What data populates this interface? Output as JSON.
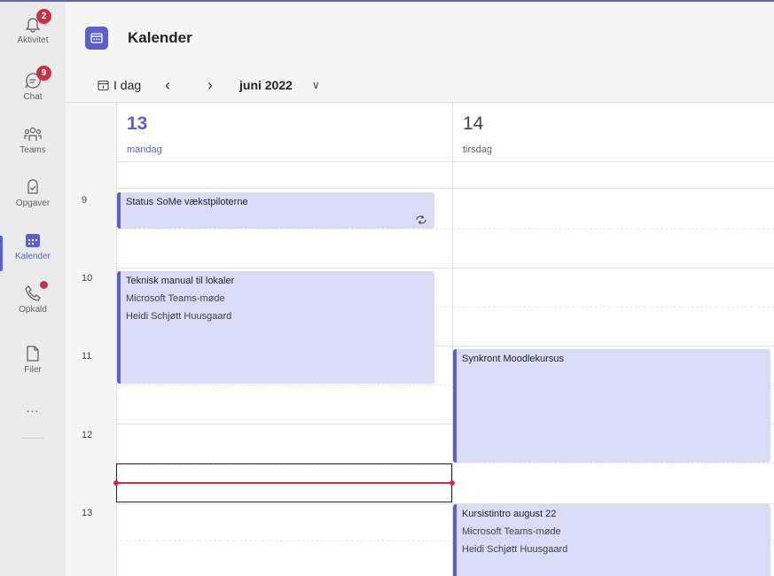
{
  "rail": {
    "items": [
      {
        "label": "Aktivitet",
        "icon": "bell-icon",
        "badge": "2"
      },
      {
        "label": "Chat",
        "icon": "chat-icon",
        "badge": "9"
      },
      {
        "label": "Teams",
        "icon": "teams-icon"
      },
      {
        "label": "Opgaver",
        "icon": "tasks-icon"
      },
      {
        "label": "Kalender",
        "icon": "calendar-icon",
        "active": true
      },
      {
        "label": "Opkald",
        "icon": "phone-icon",
        "dot": true
      },
      {
        "label": "Filer",
        "icon": "file-icon"
      }
    ],
    "more": "..."
  },
  "header": {
    "title": "Kalender"
  },
  "toolbar": {
    "today": "I dag",
    "prev": "‹",
    "next": "›",
    "month": "juni 2022",
    "chevron": "∨"
  },
  "days": [
    {
      "num": "13",
      "name": "mandag",
      "today": true
    },
    {
      "num": "14",
      "name": "tirsdag"
    }
  ],
  "hours": [
    "9",
    "10",
    "11",
    "12",
    "13"
  ],
  "events": {
    "status": {
      "title": "Status SoMe vækstpiloterne"
    },
    "manual": {
      "title": "Teknisk manual til lokaler",
      "location": "Microsoft Teams-møde",
      "organizer": "Heidi Schjøtt Huusgaard"
    },
    "moodle": {
      "title": "Synkront Moodlekursus"
    },
    "intro": {
      "title": "Kursistintro august 22",
      "location": "Microsoft Teams-møde",
      "organizer": "Heidi Schjøtt Huusgaard"
    }
  },
  "colors": {
    "accent": "#5b5fc7",
    "event_bg": "#dadcf7",
    "now": "#c4314b"
  }
}
